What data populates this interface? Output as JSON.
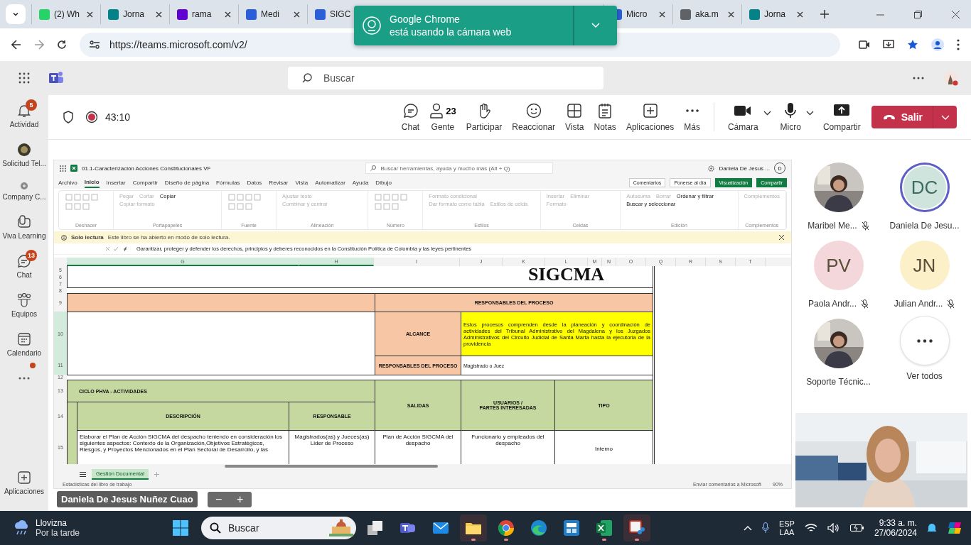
{
  "browser": {
    "tabs_left": [
      {
        "label": "(2) Wh",
        "color": "#25d366"
      },
      {
        "label": "Jorna",
        "color": "#038387"
      },
      {
        "label": "rama",
        "color": "#6001d2"
      },
      {
        "label": "Medi",
        "color": "#2b5fd9"
      }
    ],
    "tab_under_popup": {
      "label": "SIGC",
      "color": "#2b5fd9"
    },
    "tabs_right": [
      {
        "label": "Micro",
        "color": "#2b5fd9"
      },
      {
        "label": "aka.m",
        "color": "#5f6368"
      },
      {
        "label": "Jorna",
        "color": "#038387"
      }
    ],
    "url": "https://teams.microsoft.com/v2/",
    "notification": {
      "title": "Google Chrome",
      "text": "está usando la cámara web"
    }
  },
  "teams": {
    "search_placeholder": "Buscar",
    "rail_top": [
      {
        "label": "Actividad",
        "badge": "5"
      },
      {
        "label": "Solicitud Tel..."
      },
      {
        "label": "Company C..."
      },
      {
        "label": "Viva Learning"
      },
      {
        "label": "Chat",
        "badge": "13"
      },
      {
        "label": "Equipos"
      },
      {
        "label": "Calendario"
      }
    ],
    "more": {
      "alert": true
    },
    "rail_bottom": [
      {
        "label": "Aplicaciones"
      }
    ]
  },
  "meeting": {
    "timer": "43:10",
    "recording": true,
    "actions": [
      {
        "label": "Chat"
      },
      {
        "label": "Gente",
        "count": "23"
      },
      {
        "label": "Participar"
      },
      {
        "label": "Reaccionar"
      },
      {
        "label": "Vista"
      },
      {
        "label": "Notas"
      },
      {
        "label": "Aplicaciones"
      },
      {
        "label": "Más"
      }
    ],
    "devices": [
      {
        "label": "Cámara",
        "dropdown": true
      },
      {
        "label": "Micro",
        "dropdown": true
      },
      {
        "label": "Compartir",
        "dropdown": false
      }
    ],
    "leave": "Salir"
  },
  "excel": {
    "file": "01.1-Caracterización Acciones Constitucionales VF",
    "search": "Buscar herramientas, ayuda y mucho más (Alt + Q)",
    "user": "Daniela De Jesus ...",
    "avatar": "D",
    "tabs": [
      {
        "label": "Archivo",
        "selected": false
      },
      {
        "label": "Inicio",
        "selected": true
      },
      {
        "label": "Insertar",
        "selected": false
      },
      {
        "label": "Compartir",
        "selected": false
      },
      {
        "label": "Diseño de página",
        "selected": false
      },
      {
        "label": "Fórmulas",
        "selected": false
      },
      {
        "label": "Datos",
        "selected": false
      },
      {
        "label": "Revisar",
        "selected": false
      },
      {
        "label": "Vista",
        "selected": false
      },
      {
        "label": "Automatizar",
        "selected": false
      },
      {
        "label": "Ayuda",
        "selected": false
      },
      {
        "label": "Dibujo",
        "selected": false
      }
    ],
    "top_buttons": [
      {
        "label": "Comentarios",
        "primary": false
      },
      {
        "label": "Ponerse al día",
        "primary": false
      },
      {
        "label": "Visualización",
        "primary": true
      },
      {
        "label": "Compartir",
        "primary": true
      }
    ],
    "groups": [
      {
        "label": "Deshacer"
      },
      {
        "label": "Portapapeles",
        "commands": [
          {
            "label": "Pegar",
            "disabled": true
          },
          {
            "label": "Cortar",
            "disabled": true
          },
          {
            "label": "Copiar",
            "disabled": false
          },
          {
            "label": "Copiar formato",
            "disabled": true
          }
        ]
      },
      {
        "label": "Fuente"
      },
      {
        "label": "Alineación",
        "commands": [
          {
            "label": "Ajustar texto",
            "disabled": true
          },
          {
            "label": "Combinar y centrar",
            "disabled": true
          }
        ]
      },
      {
        "label": "Número"
      },
      {
        "label": "Estilos",
        "commands": [
          {
            "label": "Formato condicional",
            "disabled": true
          },
          {
            "label": "Dar formato como tabla",
            "disabled": true
          },
          {
            "label": "Estilos de celda",
            "disabled": true
          }
        ]
      },
      {
        "label": "Celdas",
        "commands": [
          {
            "label": "Insertar",
            "disabled": true
          },
          {
            "label": "Eliminar",
            "disabled": true
          },
          {
            "label": "Formato",
            "disabled": true
          }
        ]
      },
      {
        "label": "Edición",
        "commands": [
          {
            "label": "Autosuma",
            "disabled": true
          },
          {
            "label": "Borrar",
            "disabled": true
          },
          {
            "label": "Ordenar y filtrar",
            "disabled": false
          },
          {
            "label": "Buscar y seleccionar",
            "disabled": false
          }
        ]
      },
      {
        "label": "Complementos",
        "commands": [
          {
            "label": "Complementos",
            "disabled": true
          }
        ]
      }
    ],
    "notice": {
      "title": "Solo lectura",
      "text": "Este libro se ha abierto en modo de solo lectura."
    },
    "formula": "Garantizar, proteger y defender los derechos, principios y deberes reconocidos en la Constitución Política de Colombia y las leyes pertinentes",
    "sheet": {
      "columns": [
        {
          "label": "G",
          "selected": true
        },
        {
          "label": "H",
          "selected": true
        },
        {
          "label": "I",
          "selected": false
        },
        {
          "label": "J",
          "selected": false
        },
        {
          "label": "K",
          "selected": false
        },
        {
          "label": "L",
          "selected": false
        },
        {
          "label": "M",
          "selected": false
        },
        {
          "label": "N",
          "selected": false
        },
        {
          "label": "O",
          "selected": false
        },
        {
          "label": "Q",
          "selected": false
        },
        {
          "label": "R",
          "selected": false
        },
        {
          "label": "S",
          "selected": false
        },
        {
          "label": "T",
          "selected": false
        }
      ],
      "rows": [
        {
          "label": "5",
          "selected": false
        },
        {
          "label": "6",
          "selected": false
        },
        {
          "label": "7",
          "selected": false
        },
        {
          "label": "8",
          "selected": false
        },
        {
          "label": "9",
          "selected": false
        },
        {
          "label": "10",
          "selected": true
        },
        {
          "label": "11",
          "selected": true
        },
        {
          "label": "12",
          "selected": false
        },
        {
          "label": "13",
          "selected": false
        },
        {
          "label": "14",
          "selected": false
        },
        {
          "label": "15",
          "selected": false
        }
      ],
      "title": "SIGCMA",
      "header": "RESPONSABLES DEL PROCESO",
      "alcance_label": "ALCANCE",
      "alcance_text": "Estos procesos comprenden desde la planeación y coordinación de actividades del Tribunal Administrativo del Magdalena y los Juzgados Administrativos del Circuito Judicial de Santa Marta hasta la ejecutoria de la providencia",
      "responsables_label": "RESPONSABLES DEL PROCESO",
      "responsables_value": "Magistrado o Juez",
      "cycle_title": "CICLO PHVA - ACTIVIDADES",
      "table_headers": [
        "DESCRIPCIÓN",
        "RESPONSABLE",
        "SALIDAS",
        "USUARIOS /\nPARTES INTERESADAS",
        "TIPO"
      ],
      "first_row": [
        "Elaborar el Plan de Acción SIGCMA del despacho teniendo en consideración los siguientes aspectos: Contexto de la Organización,Objetivos Estratégicos, Riesgos, y Proyectos Mencionados en el Plan Sectoral de Desarrollo, y las",
        "Magistrados(as) y Jueces(as) Lider de Proceso",
        "Plan de Acción SIGCMA del despacho",
        "Funcionario y empleados del despacho",
        "Interno"
      ]
    },
    "sheet_tabs": [
      {
        "label": "Gestión Documental",
        "selected": true
      }
    ],
    "status_left": "Estadísticas del libro de trabajo",
    "status_right": "Enviar comentarios a Microsoft",
    "zoom": "90%"
  },
  "presenter": {
    "name": "Daniela De Jesus Nuñez Cuao",
    "zoom_out": "−",
    "zoom_in": "+"
  },
  "participants": [
    {
      "name": "Maribel Me...",
      "muted": true,
      "speaking": false
    },
    {
      "name": "Daniela De Jesu...",
      "kind": "initials",
      "initials": "DC",
      "color": "#cfe4dc",
      "muted": false,
      "speaking": true
    },
    {
      "name": "Paola Andr...",
      "kind": "initials",
      "initials": "PV",
      "color": "#f4d7da",
      "muted": true,
      "speaking": false
    },
    {
      "name": "Julian Andr...",
      "kind": "initials",
      "initials": "JN",
      "color": "#fbf0c8",
      "muted": true,
      "speaking": false
    },
    {
      "name": "Soporte Técnic...",
      "muted": false,
      "speaking": false
    },
    {
      "name": "Ver todos",
      "kind": "more"
    }
  ],
  "taskbar": {
    "weather": {
      "title": "Llovizna",
      "subtitle": "Por la tarde"
    },
    "search": "Buscar",
    "apps": [
      {
        "running": false,
        "selected": false
      },
      {
        "running": false,
        "selected": false
      },
      {
        "running": false,
        "selected": false
      },
      {
        "running": true,
        "selected": true
      },
      {
        "running": true,
        "selected": false
      },
      {
        "running": false,
        "selected": false
      },
      {
        "running": false,
        "selected": false
      },
      {
        "running": true,
        "selected": false
      },
      {
        "running": true,
        "selected": true
      }
    ],
    "language": "ESP",
    "layout": "LAA",
    "time": "9:33 a. m.",
    "date": "27/06/2024"
  }
}
